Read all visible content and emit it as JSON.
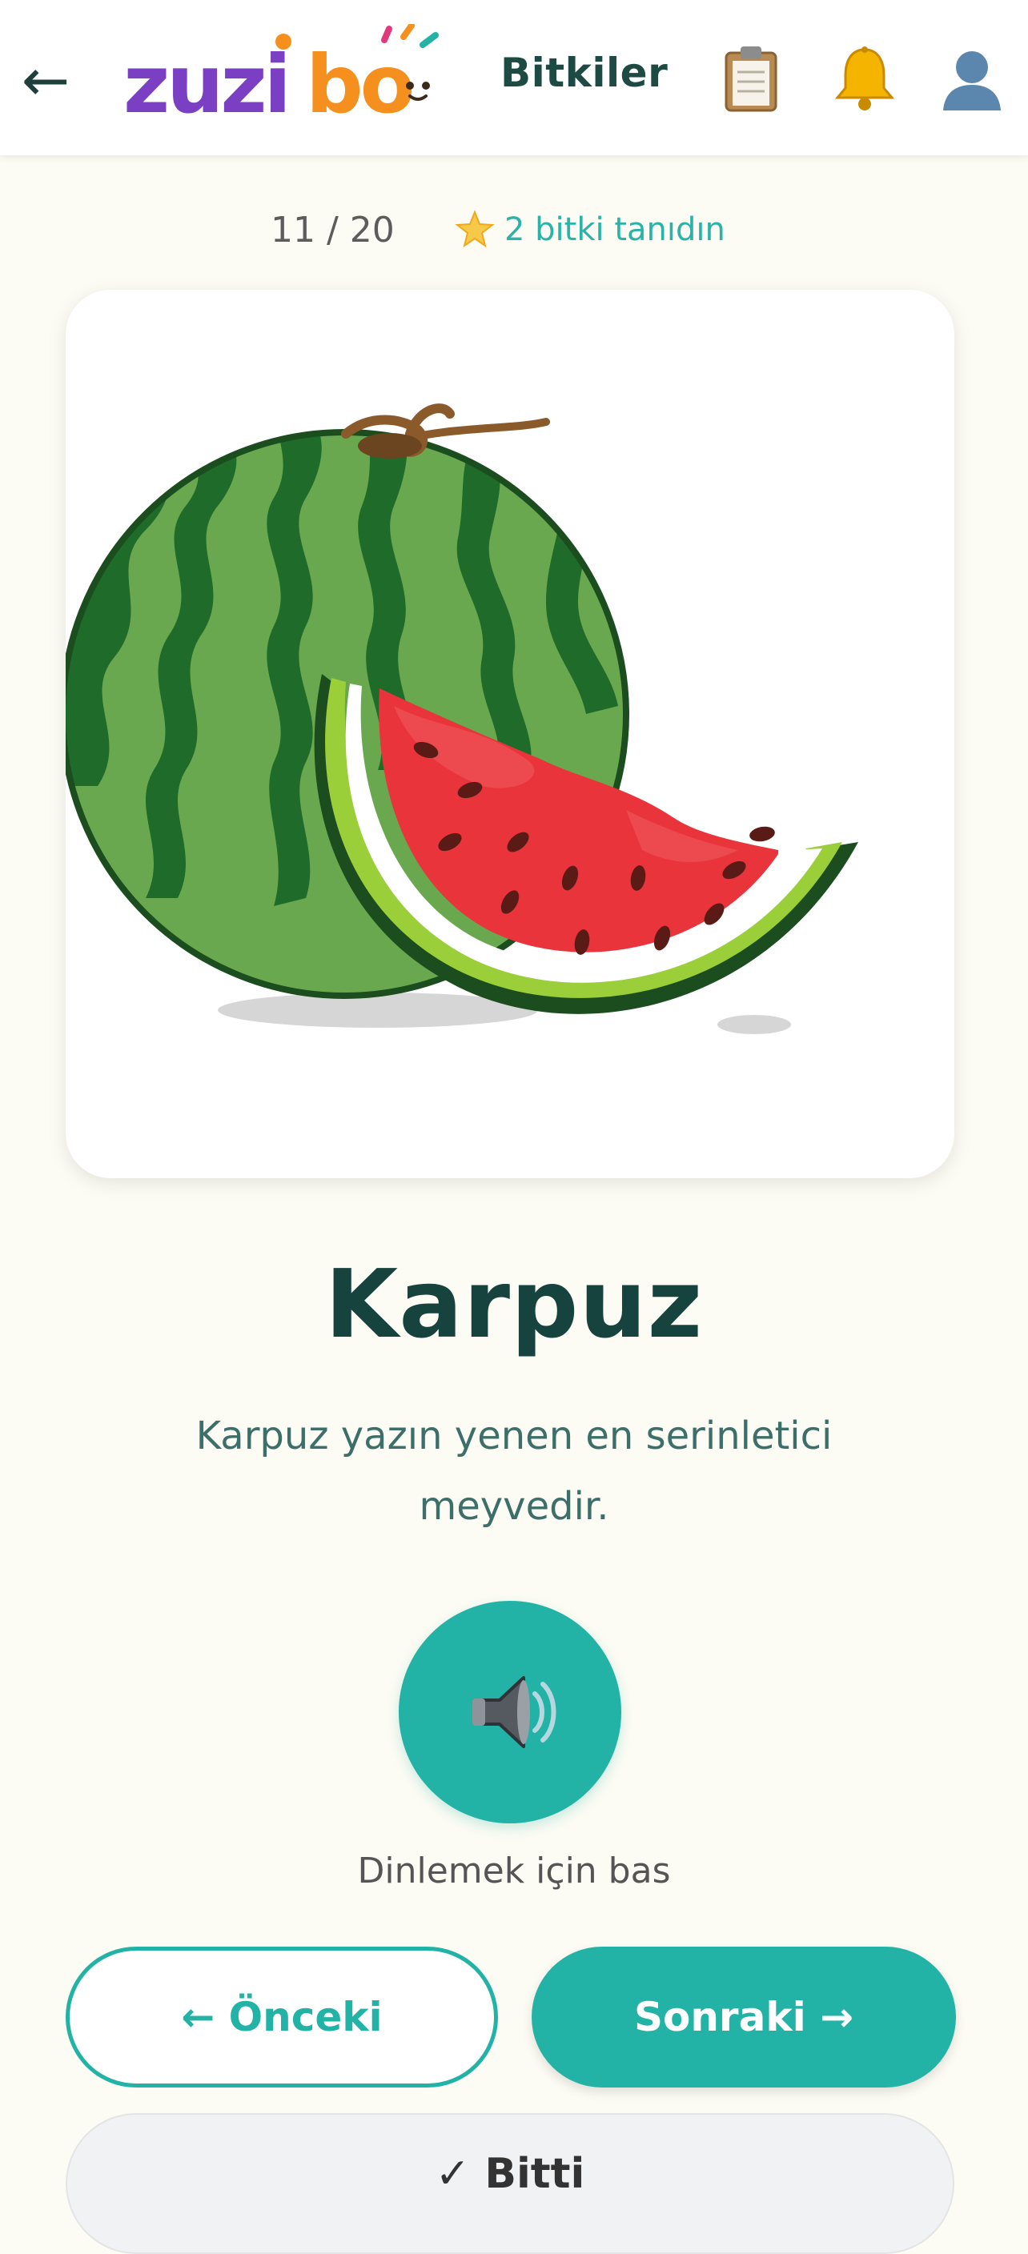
{
  "header": {
    "back_icon": "arrow-left-icon",
    "logo_text": "zuzibo",
    "title": "Bitkiler",
    "icons": [
      "clipboard-icon",
      "bell-icon",
      "user-icon"
    ]
  },
  "progress": {
    "current": 11,
    "total": 20,
    "label": "11 / 20"
  },
  "known": {
    "icon": "star-icon",
    "label": "2 bitki tanıdın"
  },
  "card": {
    "image": "watermelon-illustration"
  },
  "word": "Karpuz",
  "description": "Karpuz yazın yenen en serinletici meyvedir.",
  "audio": {
    "icon": "speaker-icon",
    "hint": "Dinlemek için bas"
  },
  "nav": {
    "prev_label": "← Önceki",
    "next_label": "Sonraki →",
    "done_label": "✓ Bitti"
  },
  "colors": {
    "accent": "#22b3a6",
    "title_dark": "#17433f",
    "background": "#fdfcf4",
    "logo_purple": "#7a3fc2",
    "logo_orange": "#f5901e"
  }
}
